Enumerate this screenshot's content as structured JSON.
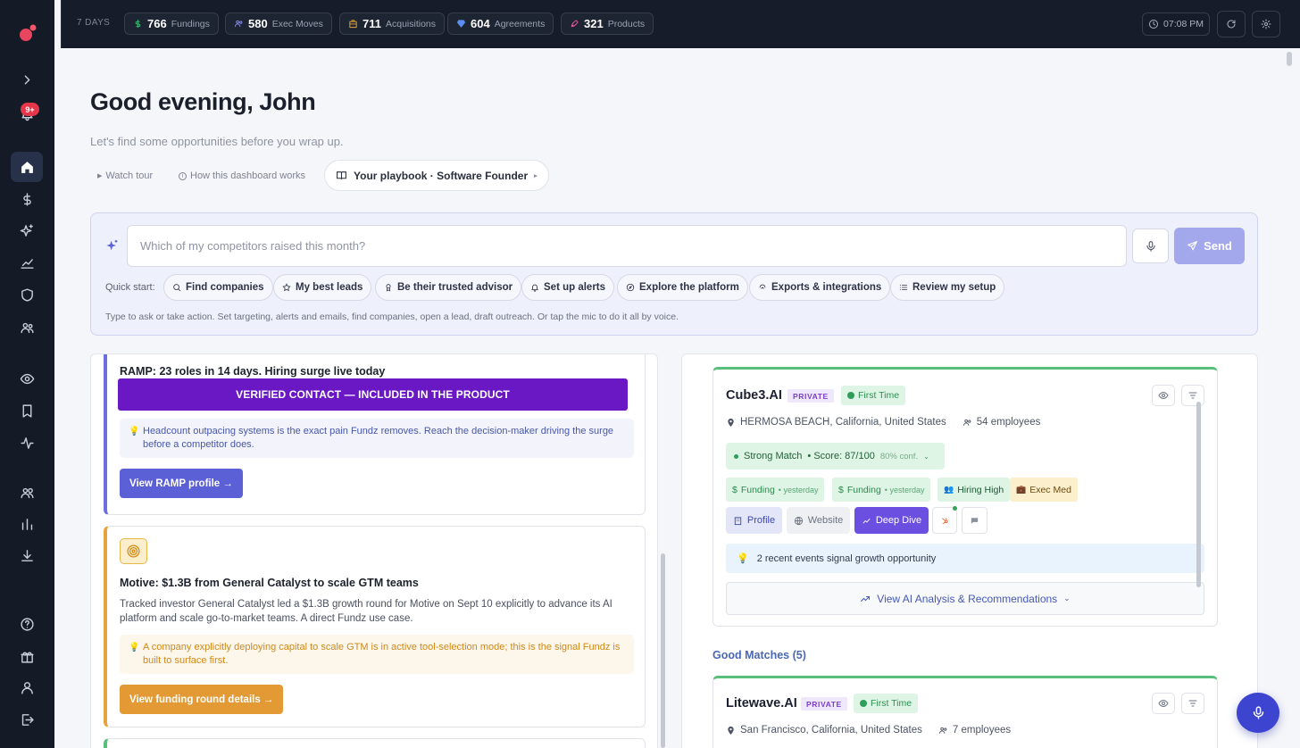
{
  "topbar": {
    "range": "7 DAYS",
    "stats": [
      {
        "value": "766",
        "label": "Fundings",
        "icon": "dollar-icon",
        "color": "#3fc07b"
      },
      {
        "value": "580",
        "label": "Exec Moves",
        "icon": "users-icon",
        "color": "#8b8ff2"
      },
      {
        "value": "711",
        "label": "Acquisitions",
        "icon": "building-icon",
        "color": "#e7a83c"
      },
      {
        "value": "604",
        "label": "Agreements",
        "icon": "handshake-icon",
        "color": "#5c8df0"
      },
      {
        "value": "321",
        "label": "Products",
        "icon": "rocket-icon",
        "color": "#ea5aa0"
      }
    ],
    "time": "07:08 PM"
  },
  "sidebar": {
    "notification_count": "9+"
  },
  "header": {
    "greeting": "Good evening, John",
    "subtitle": "Let's find some opportunities before you wrap up.",
    "watch_tour": "Watch tour",
    "how_it_works": "How this dashboard works",
    "playbook": "Your playbook · Software Founder"
  },
  "ask": {
    "placeholder": "Which of my competitors raised this month?",
    "send_label": "Send",
    "quick_start_label": "Quick start:",
    "chips": [
      {
        "label": "Find companies",
        "icon": "search-icon"
      },
      {
        "label": "My best leads",
        "icon": "star-icon"
      },
      {
        "label": "Be their trusted advisor",
        "icon": "badge-icon"
      },
      {
        "label": "Set up alerts",
        "icon": "bell-icon"
      },
      {
        "label": "Explore the platform",
        "icon": "compass-icon"
      },
      {
        "label": "Exports & integrations",
        "icon": "plug-icon"
      },
      {
        "label": "Review my setup",
        "icon": "list-icon"
      }
    ],
    "hint": "Type to ask or take action. Set targeting, alerts and emails, find companies, open a lead, draft outreach. Or tap the mic to do it all by voice."
  },
  "feed": {
    "ramp": {
      "title": "RAMP: 23 roles in 14 days. Hiring surge live today",
      "banner": "VERIFIED CONTACT — INCLUDED IN THE PRODUCT",
      "insight": "Headcount outpacing systems is the exact pain Fundz removes. Reach the decision-maker driving the surge before a competitor does.",
      "cta": "View RAMP profile →"
    },
    "motive": {
      "title": "Motive: $1.3B from General Catalyst to scale GTM teams",
      "body": "Tracked investor General Catalyst led a $1.3B growth round for Motive on Sept 10 explicitly to advance its AI platform and scale go-to-market teams. A direct Fundz use case.",
      "insight": "A company explicitly deploying capital to scale GTM is in active tool-selection mode; this is the signal Fundz is built to surface first.",
      "cta": "View funding round details →"
    }
  },
  "companies": {
    "cube": {
      "name": "Cube3.AI",
      "status": "PRIVATE",
      "first_time": "First Time",
      "location": "HERMOSA BEACH, California, United States",
      "employees": "54 employees",
      "match": "Strong Match",
      "score": "• Score:  87/100",
      "confidence": "80% conf.",
      "signals": [
        {
          "label": "Funding",
          "sub": "• yesterday"
        },
        {
          "label": "Funding",
          "sub": "• yesterday"
        },
        {
          "label": "Hiring High",
          "sub": ""
        },
        {
          "label": "Exec Med",
          "sub": ""
        }
      ],
      "profile": "Profile",
      "website": "Website",
      "deep_dive": "Deep Dive",
      "note": "2 recent events signal growth opportunity",
      "analysis": "View AI Analysis & Recommendations"
    },
    "good_matches": "Good Matches (5)",
    "litewave": {
      "name": "Litewave.AI",
      "status": "PRIVATE",
      "first_time": "First Time",
      "location": "San Francisco, California, United States",
      "employees": "7 employees"
    }
  }
}
